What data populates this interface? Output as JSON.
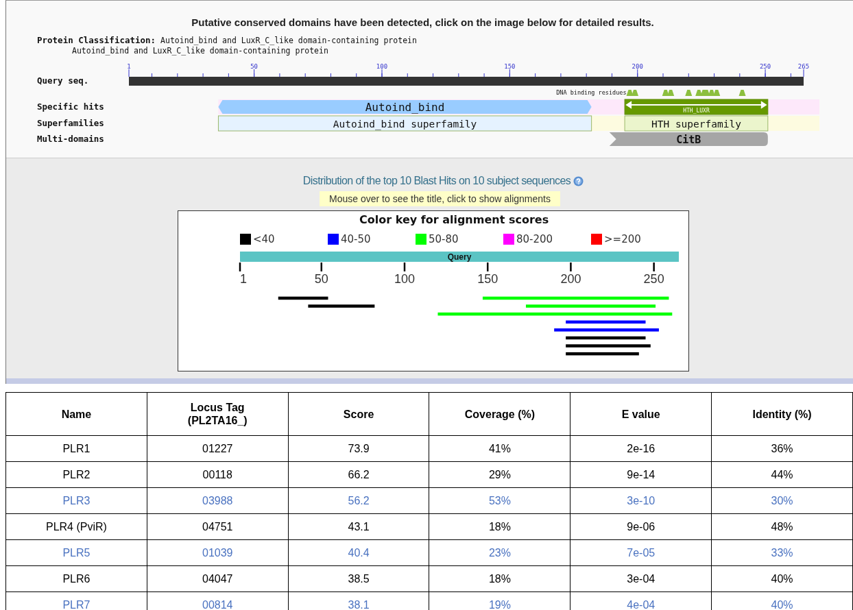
{
  "domain_panel": {
    "title": "Putative conserved domains have been detected, click on the image below for detailed results.",
    "classification_label": "Protein Classification:",
    "classification_lines": [
      "Autoind_bind and LuxR_C_like domain-containing protein",
      "Autoind_bind and LuxR_C_like domain-containing protein"
    ],
    "ruler_ticks": [
      "1",
      "50",
      "100",
      "150",
      "200",
      "250",
      "265"
    ],
    "residue_note": "DNA binding residues",
    "tracks": [
      {
        "label": "Query seq.",
        "kind": "query"
      },
      {
        "label": "Specific hits",
        "kind": "hits",
        "domains": [
          {
            "name": "Autoind_bind",
            "kind": "specific",
            "color": "#99ccff"
          },
          {
            "name": "HTH_LUXR",
            "kind": "specific_arrow",
            "color": "#669900"
          }
        ]
      },
      {
        "label": "Superfamilies",
        "kind": "hits",
        "domains": [
          {
            "name": "Autoind_bind superfamily",
            "kind": "superfamily",
            "color": "#e5f2ff"
          },
          {
            "name": "HTH superfamily",
            "kind": "superfamily",
            "color": "#ebf5cc"
          }
        ]
      },
      {
        "label": "Multi-domains",
        "kind": "hits",
        "domains": [
          {
            "name": "CitB",
            "kind": "multi",
            "color": "#a6a6a6"
          }
        ]
      }
    ]
  },
  "blast_panel": {
    "title": "Distribution of the top 10 Blast Hits on 10 subject sequences",
    "hint": "Mouse over to see the title, click to show alignments",
    "key_title": "Color key for alignment scores",
    "color_key": [
      {
        "label": "<40",
        "color": "#000000"
      },
      {
        "label": "40-50",
        "color": "#0000ff"
      },
      {
        "label": "50-80",
        "color": "#00ff00"
      },
      {
        "label": "80-200",
        "color": "#ff00ff"
      },
      {
        "label": ">=200",
        "color": "#ff0000"
      }
    ],
    "query_label": "Query",
    "ticks": [
      "1",
      "50",
      "100",
      "150",
      "200",
      "250"
    ],
    "hits": [
      {
        "color": "#000000"
      },
      {
        "color": "#000000"
      },
      {
        "color": "#00ff00"
      },
      {
        "color": "#00ff00"
      },
      {
        "color": "#00ff00"
      },
      {
        "color": "#0000ff"
      },
      {
        "color": "#0000ff"
      },
      {
        "color": "#000000"
      },
      {
        "color": "#000000"
      },
      {
        "color": "#000000"
      }
    ]
  },
  "table": {
    "columns": [
      "Name",
      "Locus Tag (PL2TA16_)",
      "Score",
      "Coverage (%)",
      "E value",
      "Identity (%)"
    ],
    "rows": [
      {
        "color": "#000000",
        "cells": [
          "PLR1",
          "01227",
          "73.9",
          "41%",
          "2e-16",
          "36%"
        ]
      },
      {
        "color": "#000000",
        "cells": [
          "PLR2",
          "00118",
          "66.2",
          "29%",
          "9e-14",
          "44%"
        ]
      },
      {
        "color": "#4a72c0",
        "cells": [
          "PLR3",
          "03988",
          "56.2",
          "53%",
          "3e-10",
          "30%"
        ]
      },
      {
        "color": "#000000",
        "cells": [
          "PLR4 (PviR)",
          "04751",
          "43.1",
          "18%",
          "9e-06",
          "48%"
        ]
      },
      {
        "color": "#4a72c0",
        "cells": [
          "PLR5",
          "01039",
          "40.4",
          "23%",
          "7e-05",
          "33%"
        ]
      },
      {
        "color": "#000000",
        "cells": [
          "PLR6",
          "04047",
          "38.5",
          "18%",
          "3e-04",
          "40%"
        ]
      },
      {
        "color": "#4a72c0",
        "cells": [
          "PLR7",
          "00814",
          "38.1",
          "19%",
          "4e-04",
          "40%"
        ]
      }
    ]
  }
}
